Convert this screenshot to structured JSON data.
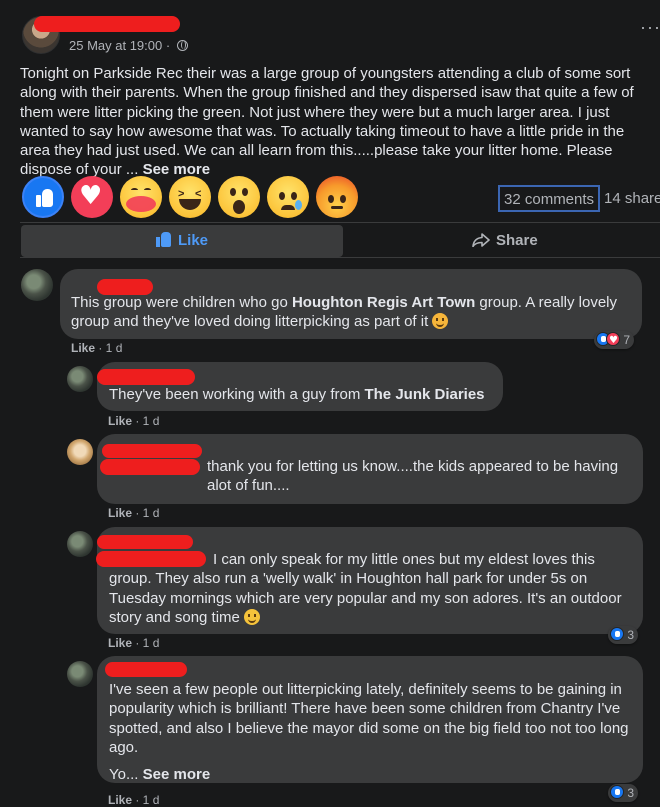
{
  "post": {
    "meta": "25 May at 19:00 · ",
    "text": "Tonight on Parkside Rec their was a large group of youngsters attending a club of some sort along with their parents. When the group finished and they dispersed isaw that quite a few of them were litter picking the green. Not just where they were but a much larger area. I just wanted to say how awesome that was. To actually taking timeout to have a little pride in the area they had just used. We can all learn from this.....please take your litter home. Please dispose of your ... ",
    "see_more": "See more",
    "more_icon": "more-dots-icon",
    "privacy_icon": "globe-icon"
  },
  "reactions": [
    "like",
    "love",
    "care",
    "haha",
    "wow",
    "sad",
    "angry"
  ],
  "stats": {
    "comments": "32 comments",
    "shares": "14 shares"
  },
  "actions": {
    "like": "Like",
    "share": "Share"
  },
  "colors": {
    "background": "#18191a",
    "bubble": "#3a3b3c",
    "like_blue": "#1877f2",
    "redaction": "#ee1e1e"
  },
  "comments": [
    {
      "text_pre": "This group were children who go ",
      "bold": "Houghton Regis Art Town",
      "text_post": " group. A really lovely group and they've loved doing litterpicking as part of it ",
      "actions": "Like",
      "time": " · 1 d",
      "reaction_count": "7"
    },
    {
      "text_pre": "They've been working with a guy from ",
      "bold": "The Junk Diaries",
      "actions": "Like",
      "time": " · 1 d"
    },
    {
      "text": "thank you for letting us know....the kids appeared to be having alot of fun....",
      "actions": "Like",
      "time": " · 1 d"
    },
    {
      "text_first": "I can only speak for my little ones but my eldest loves this",
      "text": "group. They also run a 'welly walk' in Houghton hall park for under 5s on Tuesday mornings which are very popular and my son adores. It's an outdoor story and song time ",
      "actions": "Like",
      "time": " · 1 d",
      "reaction_count": "3"
    },
    {
      "text": "I've seen a few people out litterpicking lately, definitely seems to be gaining in popularity which is brilliant! There have been some children from Chantry I've spotted, and also I believe the mayor did some on the big field too not too long ago.",
      "more_pre": "Yo... ",
      "see_more": "See more",
      "actions": "Like",
      "time": " · 1 d",
      "reaction_count": "3"
    }
  ]
}
